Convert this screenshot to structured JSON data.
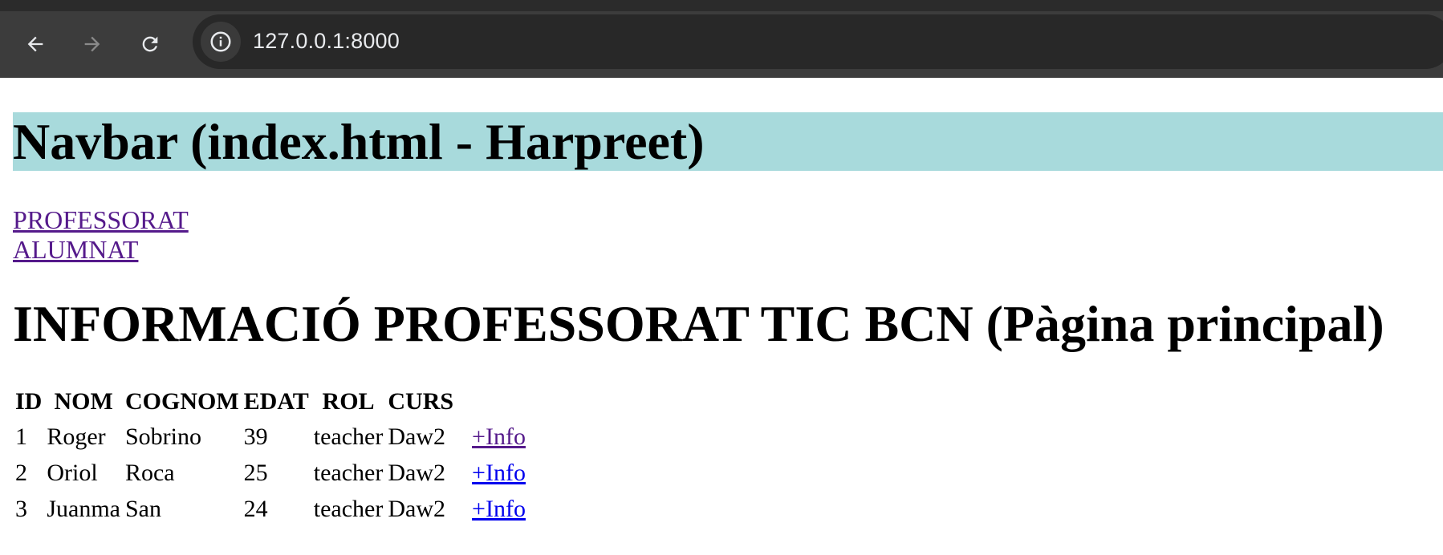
{
  "browser": {
    "url": "127.0.0.1:8000",
    "back_icon": "arrow-left-icon",
    "forward_icon": "arrow-right-icon",
    "reload_icon": "reload-icon",
    "site_info_icon": "info-icon",
    "colors": {
      "toolbar": "#3c3c3c",
      "urlbar": "#282828",
      "url_text": "#e8eaed"
    }
  },
  "page": {
    "navbar_title": "Navbar (index.html - Harpreet)",
    "navbar_color": "#a8dadc",
    "links": [
      "PROFESSORAT",
      "ALUMNAT"
    ],
    "heading": "INFORMACIÓ PROFESSORAT TIC BCN (Pàgina principal)",
    "table": {
      "headers": [
        "ID",
        "NOM",
        "COGNOM",
        "EDAT",
        "ROL",
        "CURS"
      ],
      "rows": [
        {
          "id": "1",
          "nom": "Roger",
          "cognom": "Sobrino",
          "edat": "39",
          "rol": "teacher",
          "curs": "Daw2",
          "link": "+Info"
        },
        {
          "id": "2",
          "nom": "Oriol",
          "cognom": "Roca",
          "edat": "25",
          "rol": "teacher",
          "curs": "Daw2",
          "link": "+Info"
        },
        {
          "id": "3",
          "nom": "Juanma",
          "cognom": "San",
          "edat": "24",
          "rol": "teacher",
          "curs": "Daw2",
          "link": "+Info"
        }
      ]
    }
  }
}
